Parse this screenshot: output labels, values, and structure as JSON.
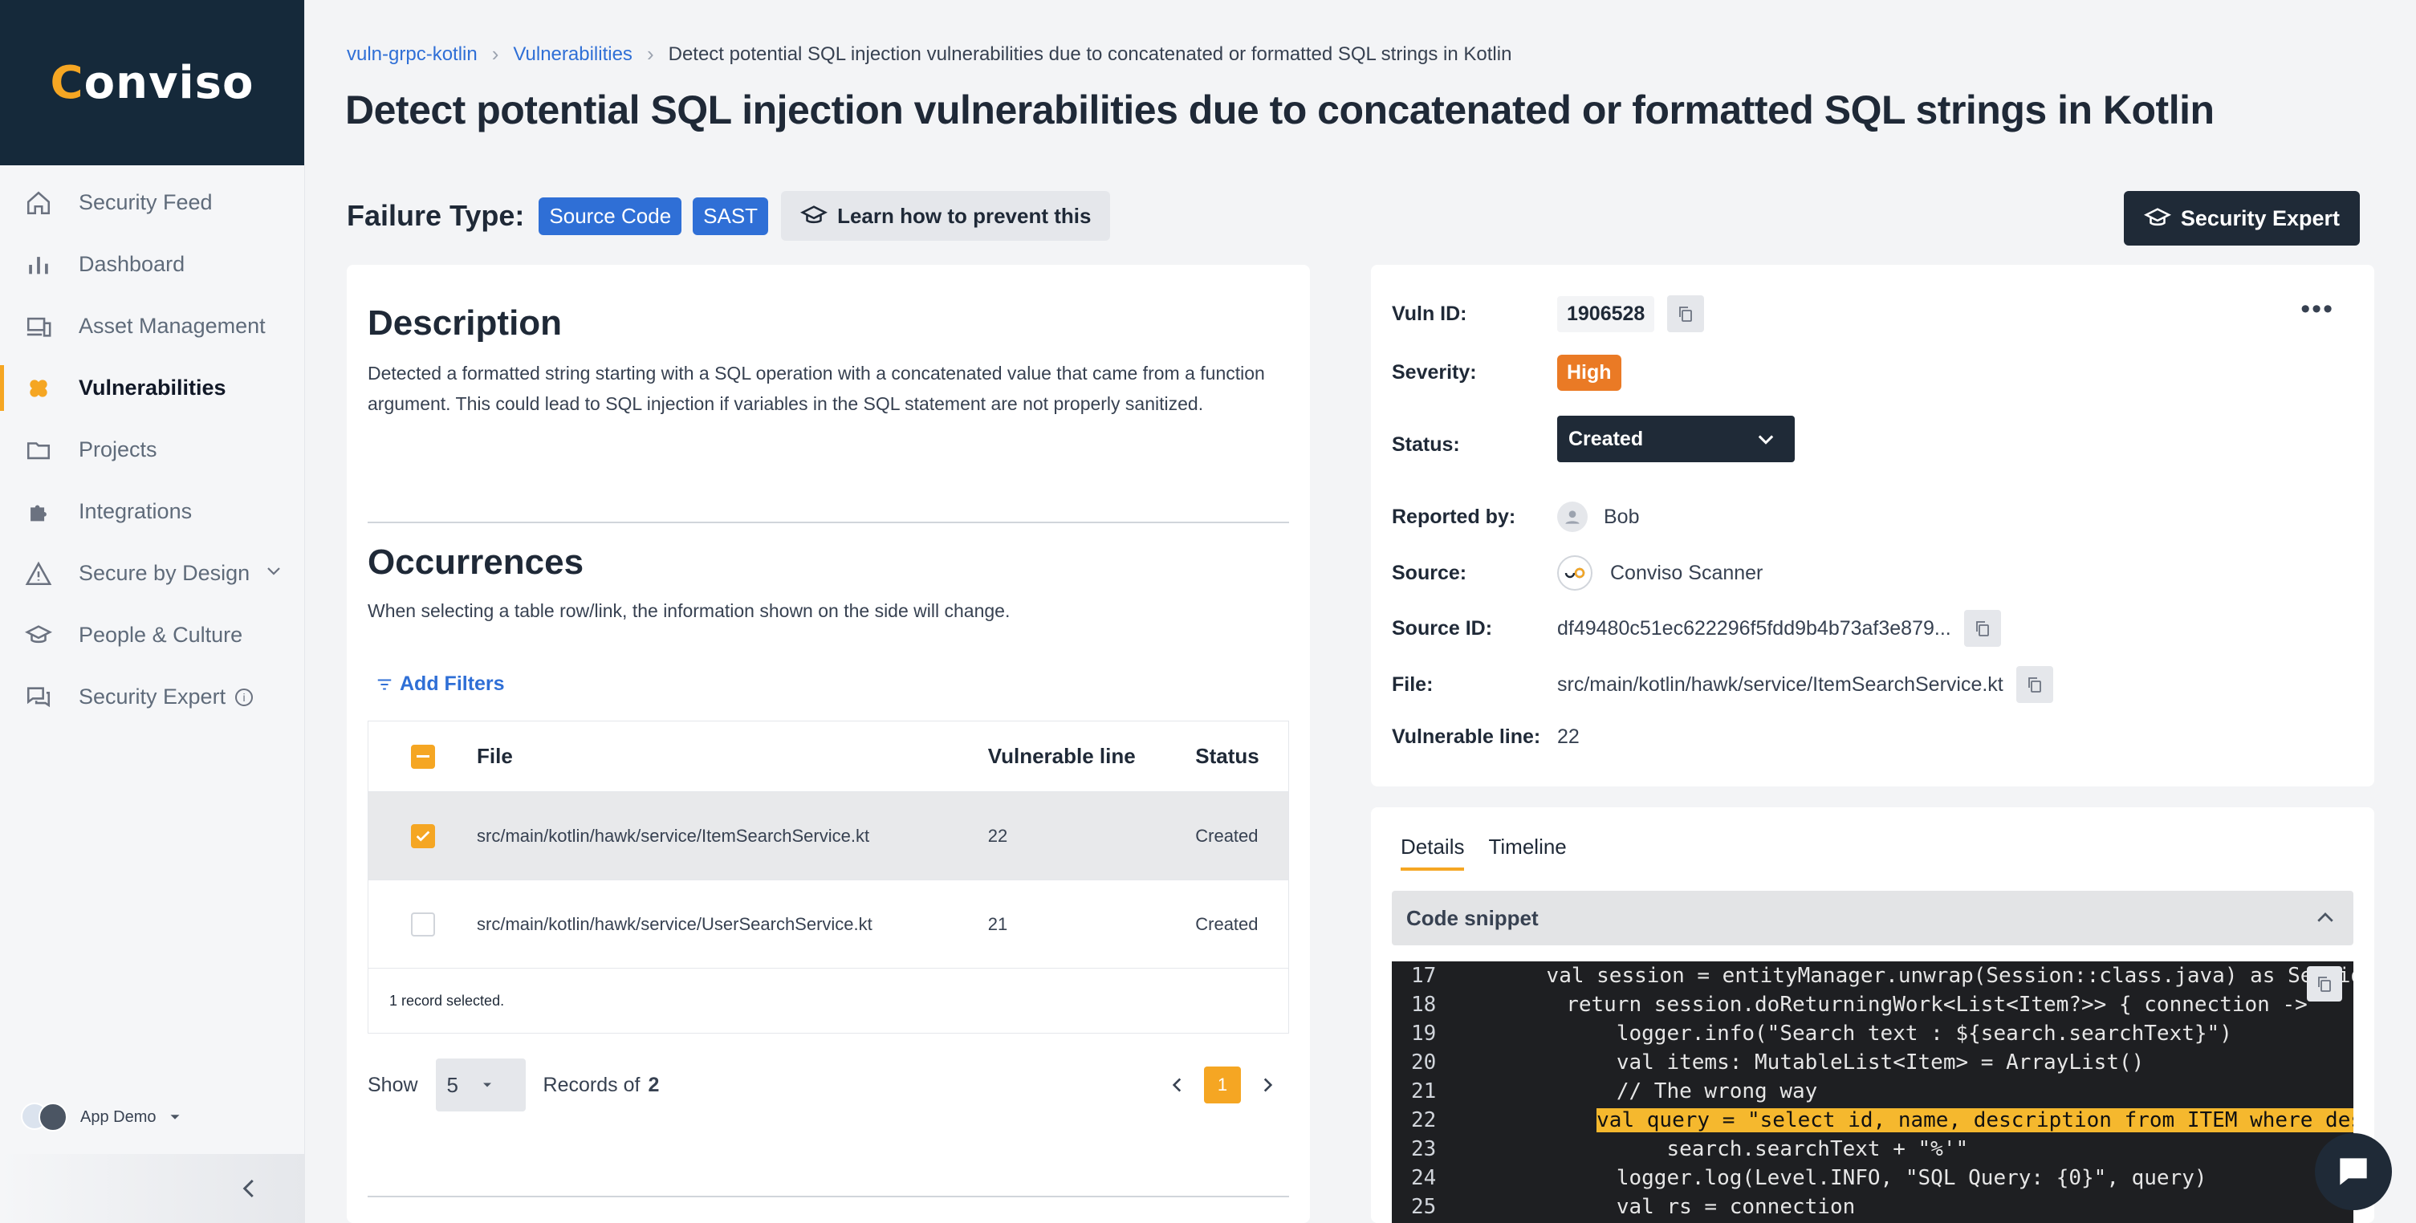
{
  "brand": {
    "logo_text": "Conviso",
    "accent": "#f5a623",
    "primary": "#2f6fd6",
    "dark": "#15293a"
  },
  "sidebar": {
    "items": [
      {
        "label": "Security Feed",
        "icon": "home-icon"
      },
      {
        "label": "Dashboard",
        "icon": "bar-chart-icon"
      },
      {
        "label": "Asset Management",
        "icon": "devices-icon"
      },
      {
        "label": "Vulnerabilities",
        "icon": "bandage-icon",
        "active": true
      },
      {
        "label": "Projects",
        "icon": "folder-icon"
      },
      {
        "label": "Integrations",
        "icon": "puzzle-icon"
      },
      {
        "label": "Secure by Design",
        "icon": "warning-icon"
      },
      {
        "label": "People & Culture",
        "icon": "graduation-cap-icon"
      },
      {
        "label": "Security Expert",
        "icon": "chat-icon"
      }
    ],
    "user": {
      "name": "App Demo"
    }
  },
  "breadcrumb": [
    "vuln-grpc-kotlin",
    "Vulnerabilities",
    "Detect potential SQL injection vulnerabilities due to concatenated or formatted SQL strings in Kotlin"
  ],
  "page": {
    "title": "Detect potential SQL injection vulnerabilities due to concatenated or formatted SQL strings in Kotlin",
    "failure_label": "Failure Type:",
    "chips": [
      "Source Code",
      "SAST"
    ],
    "learn_label": "Learn how to prevent this",
    "expert_label": "Security Expert"
  },
  "description": {
    "title": "Description",
    "text": "Detected a formatted string starting with a SQL operation with a concatenated  value that came from a function argument. This could lead to SQL injection if variables in the SQL statement are not properly sanitized."
  },
  "occurrences": {
    "title": "Occurrences",
    "subtitle": "When selecting a table row/link, the information shown on the side will change.",
    "add_filters": "Add Filters",
    "columns": [
      "File",
      "Vulnerable line",
      "Status"
    ],
    "rows": [
      {
        "file": "src/main/kotlin/hawk/service/ItemSearchService.kt",
        "line": "22",
        "status": "Created",
        "selected": true
      },
      {
        "file": "src/main/kotlin/hawk/service/UserSearchService.kt",
        "line": "21",
        "status": "Created",
        "selected": false
      }
    ],
    "footer": "1 record selected.",
    "show_label": "Show",
    "page_size": "5",
    "records_label": "Records of",
    "records_total": "2",
    "current_page": "1"
  },
  "info": {
    "vuln_id_label": "Vuln ID:",
    "vuln_id": "1906528",
    "severity_label": "Severity:",
    "severity": "High",
    "severity_color": "#ea7a25",
    "status_label": "Status:",
    "status": "Created",
    "reported_label": "Reported by:",
    "reported_by": "Bob",
    "source_label": "Source:",
    "source": "Conviso Scanner",
    "source_id_label": "Source ID:",
    "source_id": "df49480c51ec622296f5fdd9b4b73af3e879...",
    "file_label": "File:",
    "file": "src/main/kotlin/hawk/service/ItemSearchService.kt",
    "line_label": "Vulnerable line:",
    "line": "22"
  },
  "details": {
    "tabs": [
      "Details",
      "Timeline"
    ],
    "snippet_title": "Code snippet",
    "code": [
      {
        "n": "17",
        "text": "        val session = entityManager.unwrap(Session::class.java) as Session"
      },
      {
        "n": "18",
        "text": "        return session.doReturningWork<List<Item?>> { connection ->"
      },
      {
        "n": "19",
        "text": "            logger.info(\"Search text : ${search.searchText}\")"
      },
      {
        "n": "20",
        "text": "            val items: MutableList<Item> = ArrayList()"
      },
      {
        "n": "21",
        "text": "            // The wrong way"
      },
      {
        "n": "22",
        "pre": "            ",
        "text": "val query = \"select id, name, description from ITEM where description like '%\" +",
        "highlight": true
      },
      {
        "n": "23",
        "text": "                search.searchText + \"%'\""
      },
      {
        "n": "24",
        "text": "            logger.log(Level.INFO, \"SQL Query: {0}\", query)"
      },
      {
        "n": "25",
        "text": "            val rs = connection"
      }
    ]
  }
}
